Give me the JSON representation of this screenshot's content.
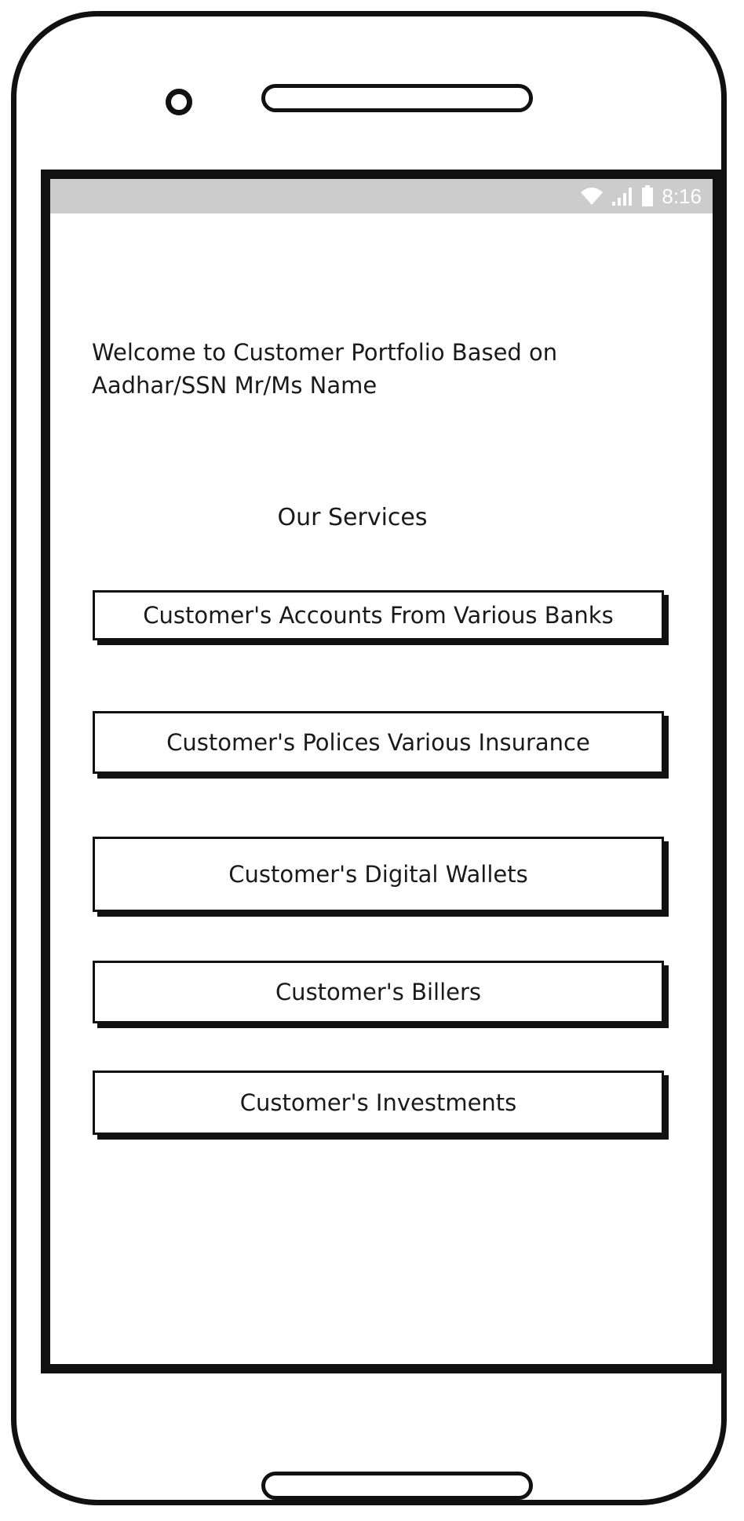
{
  "status_bar": {
    "time": "8:16",
    "icons": [
      "wifi-icon",
      "signal-icon",
      "battery-icon"
    ],
    "background_color": "#cccccc"
  },
  "welcome_text": "Welcome to Customer Portfolio Based on Aadhar/SSN Mr/Ms Name",
  "services_title": "Our Services",
  "services": [
    {
      "label": "Customer's Accounts From Various Banks"
    },
    {
      "label": "Customer's Polices Various Insurance"
    },
    {
      "label": "Customer's Digital Wallets"
    },
    {
      "label": "Customer's Billers"
    },
    {
      "label": "Customer's Investments"
    }
  ]
}
